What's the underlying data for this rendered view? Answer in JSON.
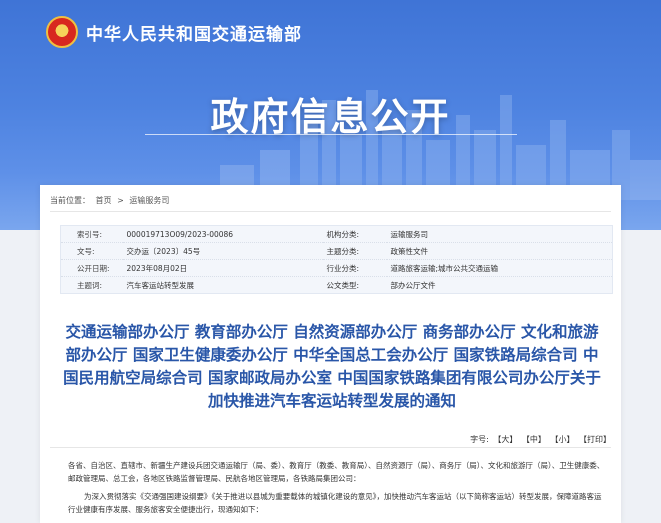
{
  "header": {
    "site_name": "中华人民共和国交通运输部",
    "page_title": "政府信息公开"
  },
  "breadcrumb": {
    "prefix": "当前位置：",
    "items": [
      "首页",
      "运输服务司"
    ],
    "separator": ">"
  },
  "meta": {
    "rows": [
      {
        "k1": "索引号:",
        "v1": "000019713O09/2023-00086",
        "k2": "机构分类:",
        "v2": "运输服务司"
      },
      {
        "k1": "文号:",
        "v1": "交办运〔2023〕45号",
        "k2": "主题分类:",
        "v2": "政策性文件"
      },
      {
        "k1": "公开日期:",
        "v1": "2023年08月02日",
        "k2": "行业分类:",
        "v2": "道路旅客运输;城市公共交通运输"
      },
      {
        "k1": "主题词:",
        "v1": "汽车客运站转型发展",
        "k2": "公文类型:",
        "v2": "部办公厅文件"
      }
    ]
  },
  "document": {
    "title": "交通运输部办公厅 教育部办公厅 自然资源部办公厅 商务部办公厅 文化和旅游部办公厅 国家卫生健康委办公厅 中华全国总工会办公厅 国家铁路局综合司 中国民用航空局综合司 国家邮政局办公室 中国国家铁路集团有限公司办公厅关于加快推进汽车客运站转型发展的通知",
    "tools": {
      "label": "字号:",
      "large": "【大】",
      "medium": "【中】",
      "small": "【小】",
      "print": "【打印】"
    },
    "para1": "各省、自治区、直辖市、新疆生产建设兵团交通运输厅（局、委）、教育厅（教委、教育局）、自然资源厅（局）、商务厅（局）、文化和旅游厅（局）、卫生健康委、邮政管理局、总工会，各地区铁路监督管理局、民航各地区管理局，各铁路局集团公司：",
    "para2": "为深入贯彻落实《交通强国建设纲要》《关于推进以县城为重要载体的城镇化建设的意见》，加快推动汽车客运站（以下简称客运站）转型发展，保障道路客运行业健康有序发展、服务旅客安全便捷出行，现通知如下："
  },
  "colors": {
    "hero_top": "#3f74d6",
    "title_blue": "#2956a8"
  }
}
